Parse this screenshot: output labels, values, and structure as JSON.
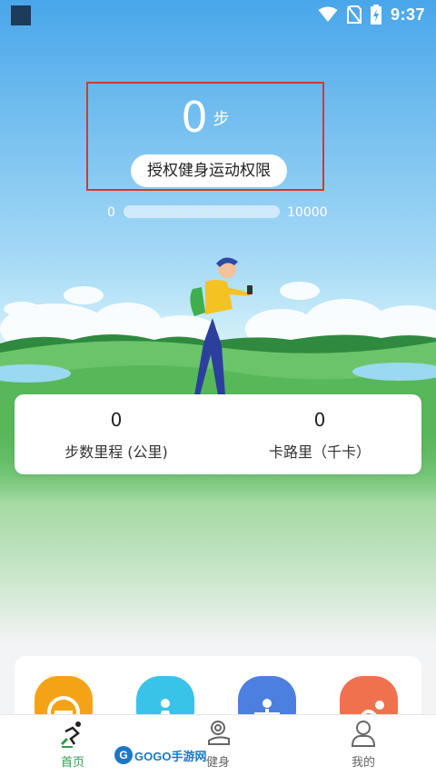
{
  "status_bar": {
    "time": "9:37"
  },
  "steps": {
    "value": "0",
    "unit": "步",
    "auth_button": "授权健身运动权限"
  },
  "progress": {
    "min_label": "0",
    "max_label": "10000",
    "fraction": 0
  },
  "stats": [
    {
      "value": "0",
      "label": "步数里程 (公里)"
    },
    {
      "value": "0",
      "label": "卡路里（千卡）"
    }
  ],
  "features": [
    {
      "icon": "scale-icon",
      "color": "#f5a316"
    },
    {
      "icon": "meditation-icon",
      "color": "#3ac3e8"
    },
    {
      "icon": "stretch-icon",
      "color": "#4d7fe0"
    },
    {
      "icon": "yoga-icon",
      "color": "#f0714e"
    }
  ],
  "bottom_nav": [
    {
      "label": "首页",
      "icon": "runner-icon",
      "active": true
    },
    {
      "label": "健身",
      "icon": "kettlebell-icon",
      "active": false
    },
    {
      "label": "我的",
      "icon": "user-icon",
      "active": false
    }
  ],
  "watermark": {
    "text": "GOGO手游网"
  },
  "colors": {
    "accent_green": "#2f9b4c",
    "sky_blue": "#49a6ea",
    "highlight_red": "#d23a2a"
  }
}
